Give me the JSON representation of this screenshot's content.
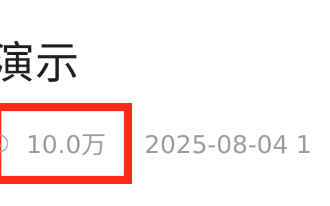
{
  "video": {
    "title_fragment": "演示",
    "view_count": "10.0万",
    "publish_date": "2025-08-04 1",
    "icons": {
      "views": "play-count-icon"
    },
    "highlight_color": "#ff2a17"
  }
}
